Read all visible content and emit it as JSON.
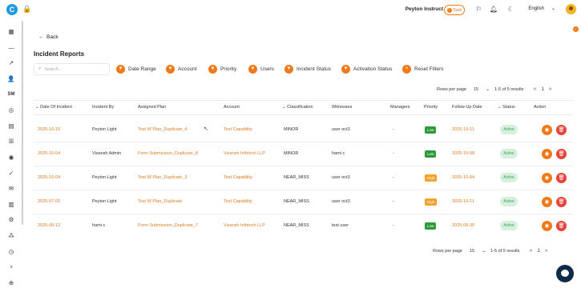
{
  "header": {
    "user_name": "Peyton Instruct",
    "task_label": "Task",
    "language": "English"
  },
  "sidebar": {
    "items": [
      {
        "icon": "grid-icon",
        "glyph": "▦"
      },
      {
        "icon": "minus-icon",
        "glyph": "—"
      },
      {
        "icon": "chart-icon",
        "glyph": "↗"
      },
      {
        "icon": "user-settings-icon",
        "glyph": "👤"
      },
      {
        "icon": "sm-icon",
        "glyph": "SM"
      },
      {
        "icon": "profile-icon",
        "glyph": "◎"
      },
      {
        "icon": "document-icon",
        "glyph": "▤"
      },
      {
        "icon": "team-icon",
        "glyph": "ꕥ"
      },
      {
        "icon": "target-icon",
        "glyph": "◉"
      },
      {
        "icon": "check-circle-icon",
        "glyph": "✓"
      },
      {
        "icon": "mail-icon",
        "glyph": "✉"
      },
      {
        "icon": "clipboard-icon",
        "glyph": "▥"
      },
      {
        "icon": "settings-icon",
        "glyph": "⚙"
      },
      {
        "icon": "hierarchy-icon",
        "glyph": "⁂"
      },
      {
        "icon": "clock-icon",
        "glyph": "◷"
      },
      {
        "icon": "trophy-icon",
        "glyph": "♆"
      },
      {
        "icon": "add-circle-icon",
        "glyph": "⊕"
      }
    ]
  },
  "page": {
    "back_label": "Back",
    "title": "Incident Reports",
    "search_placeholder": "Search..."
  },
  "filters": [
    "Date Range",
    "Account",
    "Priority",
    "Users",
    "Incident Status",
    "Activation Status",
    "Reset Filters"
  ],
  "pagination": {
    "rows_per_page_label": "Rows per page",
    "rows_per_page": "15",
    "range": "1-5 of 5 results",
    "page": "1"
  },
  "table": {
    "columns": [
      "Date Of Incident",
      "Incident By",
      "Assigned Plan",
      "Account",
      "Classification",
      "Witnesses",
      "Managers",
      "Priority",
      "Follow Up Date",
      "Status",
      "Action"
    ],
    "rows": [
      {
        "date": "2025-10-10",
        "by": "Peyton Light",
        "plan": "Test W Plan_Duplicate_4",
        "account": "Test Capability",
        "classification": "MINOR",
        "witnesses": "user oct3",
        "managers": "-",
        "priority": "Low",
        "follow_up": "2025-10-11",
        "status": "Active"
      },
      {
        "date": "2025-10-04",
        "by": "Vivansh Admin",
        "plan": "Form Submission_Duplicate_8",
        "account": "Vivansh Infotech LLP",
        "classification": "MINOR",
        "witnesses": "hami c",
        "managers": "-",
        "priority": "Low",
        "follow_up": "2025-10-08",
        "status": "Active"
      },
      {
        "date": "2025-10-04",
        "by": "Peyton Light",
        "plan": "Test W Plan_Duplicate_3",
        "account": "Test Capability",
        "classification": "NEAR_MISS",
        "witnesses": "user oct3",
        "managers": "-",
        "priority": "High",
        "follow_up": "2025-10-04",
        "status": "Active"
      },
      {
        "date": "2025-07-02",
        "by": "Peyton Light",
        "plan": "Test W Plan_Duplicate",
        "account": "Test Capability",
        "classification": "NEAR_MISS",
        "witnesses": "user oct3",
        "managers": "-",
        "priority": "High",
        "follow_up": "2025-10-11",
        "status": "Active"
      },
      {
        "date": "2025-09-12",
        "by": "hami c",
        "plan": "Form Submission_Duplicate_7",
        "account": "Vivansh Infotech LLP",
        "classification": "NEAR_MISS",
        "witnesses": "test user",
        "managers": "-",
        "priority": "Low",
        "follow_up": "2025-09-30",
        "status": "Active"
      }
    ]
  }
}
